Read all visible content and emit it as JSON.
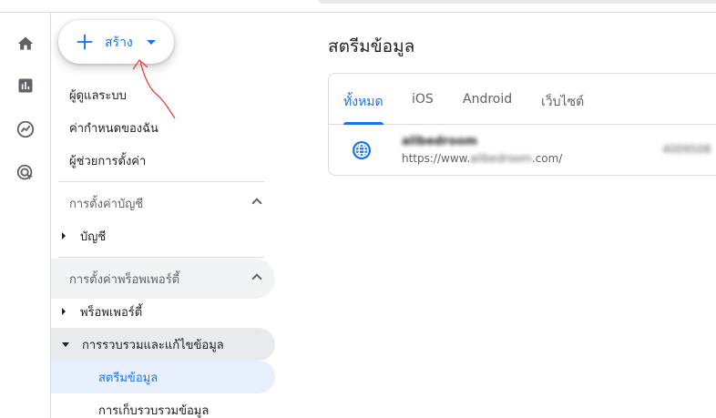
{
  "create": {
    "label": "สร้าง"
  },
  "nav": {
    "top_items": [
      "ผู้ดูแลระบบ",
      "ค่ากำหนดของฉัน",
      "ผู้ช่วยการตั้งค่า"
    ],
    "account_section": {
      "title": "การตั้งค่าบัญชี",
      "items": [
        "บัญชี"
      ]
    },
    "property_section": {
      "title": "การตั้งค่าพร็อพเพอร์ตี้",
      "items": [
        "พร็อพเพอร์ตี้",
        "การรวบรวมและแก้ไขข้อมูล"
      ],
      "subitems": [
        "สตรีมข้อมูล",
        "การเก็บรวบรวมข้อมูล"
      ]
    }
  },
  "main": {
    "title": "สตรีมข้อมูล",
    "tabs": [
      "ทั้งหมด",
      "iOS",
      "Android",
      "เว็บไซต์"
    ],
    "active_tab": "ทั้งหมด",
    "streams": [
      {
        "name": "alibedroom",
        "url_prefix": "https://www.",
        "url_blurred": "alibedroom",
        "url_suffix": ".com/",
        "id": "4009508"
      }
    ]
  },
  "colors": {
    "accent": "#1a73e8",
    "annotation": "#e53935",
    "selected_bg": "#e8f0fe",
    "expanded_bg": "#e8eaed"
  }
}
